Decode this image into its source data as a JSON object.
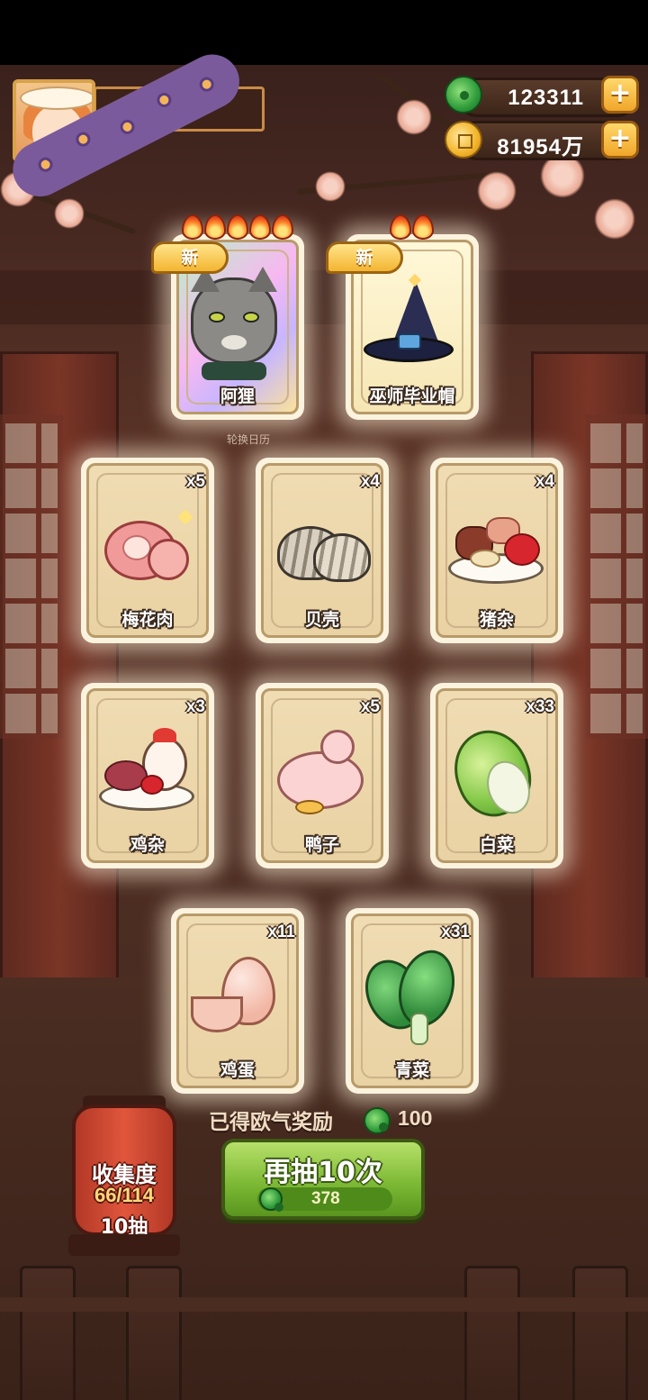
{
  "hud": {
    "jade_amount": "123311",
    "coin_amount": "81954万",
    "add_label": "+"
  },
  "background": {
    "calendar_label": "轮换日历"
  },
  "cards": [
    {
      "name": "阿狸",
      "count": "",
      "is_new": true,
      "new_label": "新",
      "stars": 5,
      "art": "cat-icon"
    },
    {
      "name": "巫师毕业帽",
      "count": "",
      "is_new": true,
      "new_label": "新",
      "stars": 2,
      "art": "wizard-hat-icon"
    },
    {
      "name": "梅花肉",
      "count": "x5",
      "art": "pork-icon"
    },
    {
      "name": "贝壳",
      "count": "x4",
      "art": "shell-icon"
    },
    {
      "name": "猪杂",
      "count": "x4",
      "art": "pork-offal-icon"
    },
    {
      "name": "鸡杂",
      "count": "x3",
      "art": "chicken-offal-icon"
    },
    {
      "name": "鸭子",
      "count": "x5",
      "art": "duck-icon"
    },
    {
      "name": "白菜",
      "count": "x33",
      "art": "cabbage-icon"
    },
    {
      "name": "鸡蛋",
      "count": "x11",
      "art": "egg-icon"
    },
    {
      "name": "青菜",
      "count": "x31",
      "art": "greens-icon"
    }
  ],
  "reward": {
    "label": "已得欧气奖励",
    "value": "100"
  },
  "draw_button": {
    "label": "再抽10次",
    "cost": "378"
  },
  "collection": {
    "title": "收集度",
    "progress": "66/114",
    "draws": "10抽"
  }
}
